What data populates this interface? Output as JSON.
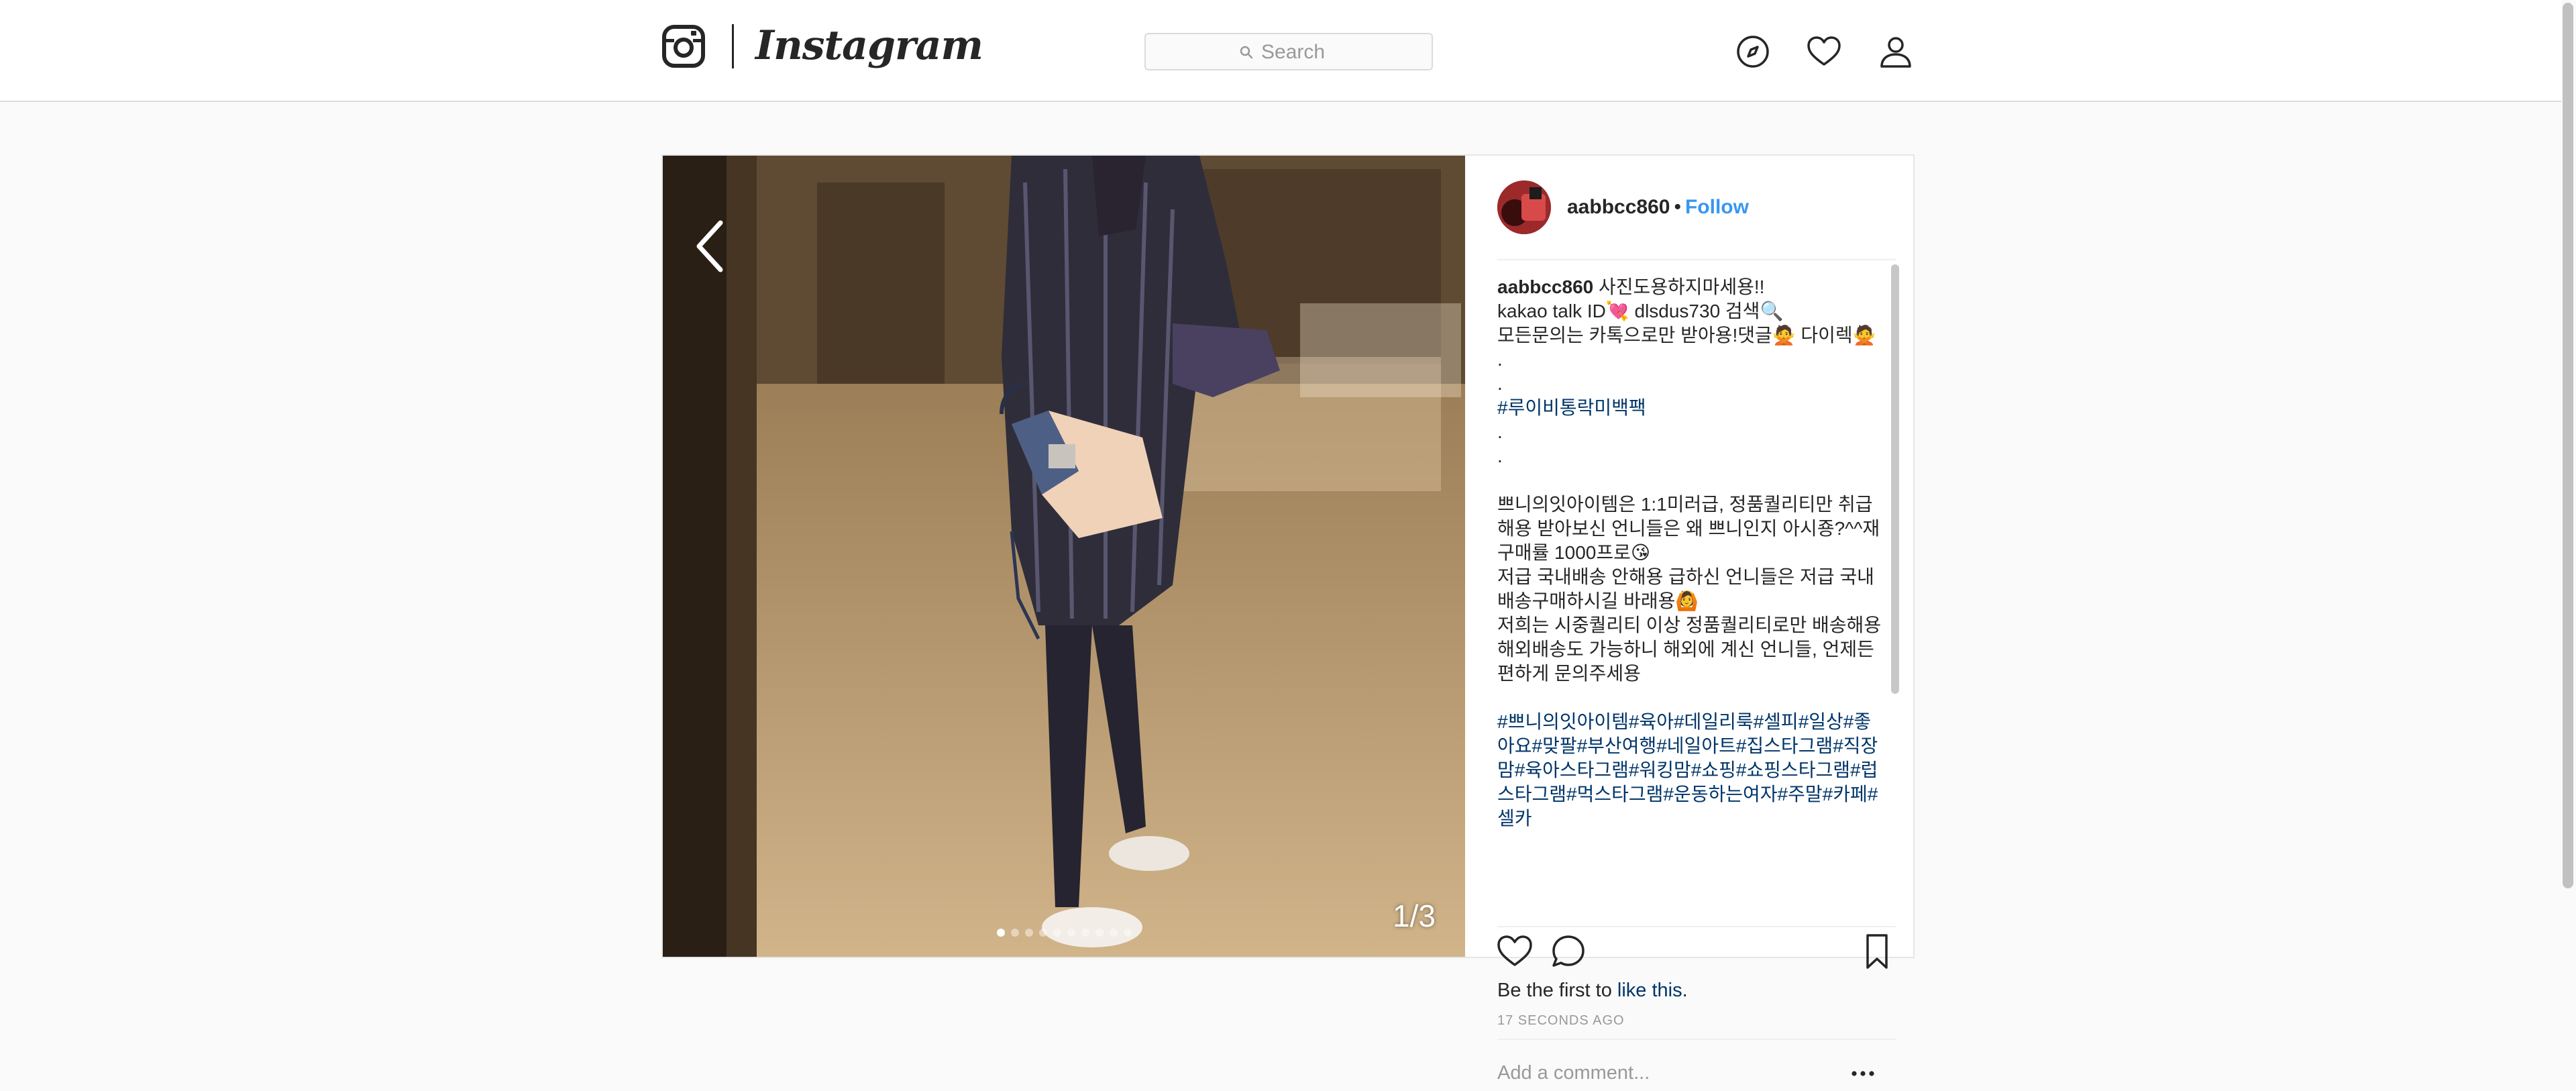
{
  "nav": {
    "brand": "Instagram",
    "search_placeholder": "Search",
    "icons": [
      "compass-icon",
      "heart-icon",
      "profile-icon"
    ]
  },
  "post": {
    "photo": {
      "counter": "1/3",
      "slide_count": 10,
      "active_slide": 0
    },
    "header": {
      "username": "aabbcc860",
      "separator": "•",
      "follow_label": "Follow"
    },
    "caption": {
      "owner": "aabbcc860",
      "line1": " 사진도용하지마세용!!",
      "line2": "kakao talk ID💘 dlsdus730 검색🔍",
      "line3": "모든문의는 카톡으로만 받아용!댓글🙅 다이렉🙅  .",
      "line4": ".",
      "hashtag1": "#루이비통락미백팩",
      "line5": ".",
      "line6": ".",
      "body1": "쁘니의잇아이템은 1:1미러급, 정품퀄리티만 취급해용 받아보신 언니들은 왜 쁘니인지 아시죵?^^재구매률 1000프로😘",
      "body2": "저급 국내배송 안해용 급하신 언니들은 저급 국내배송구매하시길 바래용🙆",
      "body3": "저희는 시중퀄리티 이상 정품퀄리티로만 배송해용 해외배송도 가능하니 해외에 계신 언니들, 언제든 편하게 문의주세용",
      "hashtags": "#쁘니의잇아이템#육아#데일리룩#셀피#일상#좋아요#맞팔#부산여행#네일아트#집스타그램#직장맘#육아스타그램#워킹맘#쇼핑#쇼핑스타그램#럽스타그램#먹스타그램#운동하는여자#주말#카페#셀카"
    },
    "likes": {
      "prefix": "Be the first to ",
      "link": "like this",
      "suffix": "."
    },
    "timestamp": "17 SECONDS AGO",
    "comment_placeholder": "Add a comment..."
  },
  "colors": {
    "link_blue": "#3897f0",
    "hashtag_navy": "#003569",
    "muted_gray": "#999999",
    "border": "#dbdbdb"
  }
}
